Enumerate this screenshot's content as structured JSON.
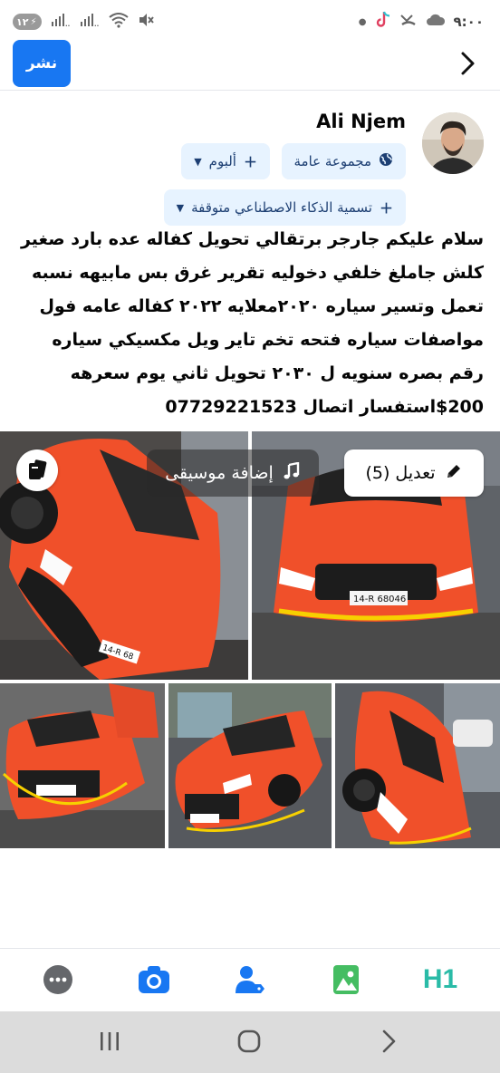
{
  "status_bar": {
    "battery": "١٢",
    "time": "٩:٠٠",
    "signal_icons": [
      "battery-icon",
      "signal-icon",
      "signal-icon",
      "wifi-icon",
      "mute-icon"
    ],
    "notification_icons": [
      "dot-icon",
      "tiktok-icon",
      "missed-call-icon",
      "cloud-icon"
    ]
  },
  "header": {
    "publish_label": "نشر",
    "back_icon": "chevron-right-icon"
  },
  "user": {
    "name": "Ali Njem"
  },
  "chips": {
    "audience_label": "مجموعة عامة",
    "album_label": "ألبوم",
    "ai_label": "تسمية الذكاء الاصطناعي متوقفة"
  },
  "post": {
    "text": "سلام عليكم جارجر برتقالي تحويل كفاله عده بارد صغير كلش جاملغ خلفي دخوليه تقرير غرق بس مابيهه نسبه تعمل وتسير سياره ٢٠٢٠معلايه ٢٠٢٢ كفاله عامه فول مواصفات سياره فتحه تخم تاير ويل مكسيكي سياره رقم بصره سنويه ل ٢٠٣٠ تحويل ثاني يوم  سعرهه 200$استفسار اتصال 07729221523"
  },
  "photos": {
    "edit_label": "تعديل (5)",
    "music_label": "إضافة موسيقى",
    "plate": "14-R 68046"
  },
  "toolbar": {
    "items": [
      "more-icon",
      "camera-icon",
      "tag-people-icon",
      "photo-icon",
      "heading-icon"
    ],
    "heading_text": "H1"
  },
  "colors": {
    "accent": "#1877f2",
    "chip_bg": "#e7f3ff",
    "car_orange": "#f0502a",
    "nav_bg": "#dcdcdc"
  }
}
